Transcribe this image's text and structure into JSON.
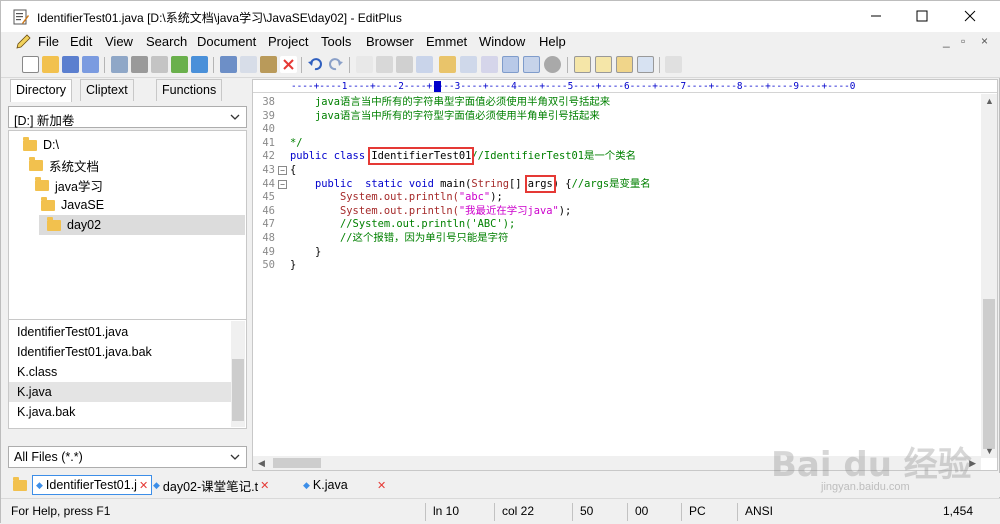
{
  "window": {
    "title": "IdentifierTest01.java [D:\\系统文档\\java学习\\JavaSE\\day02] - EditPlus"
  },
  "menu": {
    "items": [
      "File",
      "Edit",
      "View",
      "Search",
      "Document",
      "Project",
      "Tools",
      "Browser",
      "Emmet",
      "Window",
      "Help"
    ],
    "mdi_buttons": [
      "_",
      "▫",
      "×"
    ]
  },
  "toolbar": {
    "icons": [
      "new-icon",
      "open-icon",
      "save-icon",
      "save-all-icon",
      "ftp-icon",
      "print-icon",
      "print-preview-icon",
      "spell-check-icon",
      "refresh-icon",
      "cut-icon",
      "copy-icon",
      "paste-icon",
      "delete-icon",
      "undo-icon",
      "redo-icon",
      "find-icon",
      "replace-icon",
      "goto-icon",
      "font-icon",
      "hex-icon",
      "word-wrap-icon",
      "ruler-icon",
      "line-number-icon",
      "settings-icon",
      "directory-window-icon",
      "output-window-icon",
      "cliptext-icon",
      "browser-icon",
      "help-icon"
    ]
  },
  "left_panel": {
    "tabs": [
      "Directory",
      "Cliptext",
      "Functions"
    ],
    "active_tab": "Directory",
    "drive": "[D:] 新加卷",
    "tree": [
      "D:\\",
      "系统文档",
      "java学习",
      "JavaSE",
      "day02"
    ],
    "selected_folder": "day02",
    "files": [
      "IdentifierTest01.java",
      "IdentifierTest01.java.bak",
      "K.class",
      "K.java",
      "K.java.bak"
    ],
    "selected_file": "K.java",
    "filter": "All Files (*.*)"
  },
  "editor": {
    "ruler": "----+----1----+----2----+----3----+----4----+----5----+----6----+----7----+----8----+----9----+----0",
    "lines": [
      {
        "n": "38",
        "text": "    java语言当中所有的字符串型字面值必须使用半角双引号括起来"
      },
      {
        "n": "39",
        "text": "    java语言当中所有的字符型字面值必须使用半角单引号括起来"
      },
      {
        "n": "40",
        "text": ""
      },
      {
        "n": "41",
        "text": "*/"
      },
      {
        "n": "42",
        "text": "public class IdentifierTest01//IdentifierTest01是一个类名"
      },
      {
        "n": "43",
        "text": "{"
      },
      {
        "n": "44",
        "text": "    public  static void main(String[] args) {//args是变量名"
      },
      {
        "n": "45",
        "text": "        System.out.println(\"abc\");"
      },
      {
        "n": "46",
        "text": "        System.out.println(\"我最近在学习java\");"
      },
      {
        "n": "47",
        "text": "        //System.out.println('ABC');"
      },
      {
        "n": "48",
        "text": "        //这个报错，因为单引号只能是字符"
      },
      {
        "n": "49",
        "text": "    }"
      },
      {
        "n": "50",
        "text": "}"
      }
    ],
    "code": {
      "c38": "    java语言当中所有的字符串型字面值必须使用半角双引号括起来",
      "c39": "    java语言当中所有的字符型字面值必须使用半角单引号括起来",
      "c41": "*/",
      "c42_kw": "public class ",
      "c42_name": "IdentifierTest01",
      "c42_cm": "//IdentifierTest01是一个类名",
      "c43": "{",
      "c44_kw1": "    public  static void ",
      "c44_main": "main(",
      "c44_ty": "String",
      "c44_br": "[] ",
      "c44_args": "args",
      "c44_rest": ") {",
      "c44_cm": "//args是变量名",
      "c45_a": "        System.out.println(",
      "c45_s": "\"abc\"",
      "c45_b": ");",
      "c46_a": "        System.out.println(",
      "c46_s": "\"我最近在学习java\"",
      "c46_b": ");",
      "c47": "        //System.out.println('ABC');",
      "c48": "        //这个报错，因为单引号只能是字符",
      "c49": "    }",
      "c50": "}"
    }
  },
  "doc_tabs": [
    {
      "label": "IdentifierTest01.j",
      "active": true
    },
    {
      "label": "day02-课堂笔记.t",
      "active": false
    },
    {
      "label": "K.java",
      "active": false
    }
  ],
  "status": {
    "help": "For Help, press F1",
    "ln": "ln 10",
    "col": "col 22",
    "v50": "50",
    "v00": "00",
    "mode": "PC",
    "encoding": "ANSI",
    "size": "1,454"
  },
  "watermark": {
    "big": "Bai du 经验",
    "small": "jingyan.baidu.com"
  }
}
